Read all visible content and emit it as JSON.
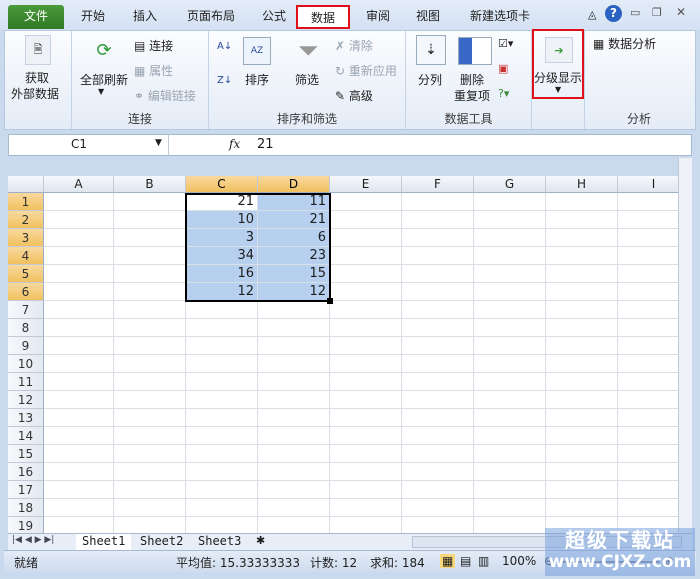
{
  "tabs": [
    "文件",
    "开始",
    "插入",
    "页面布局",
    "公式",
    "数据",
    "审阅",
    "视图",
    "新建选项卡"
  ],
  "ribbon": {
    "get_external": [
      "获取",
      "外部数据"
    ],
    "refresh_all": "全部刷新",
    "connections": "连接",
    "properties": "属性",
    "edit_links": "编辑链接",
    "group_connections": "连接",
    "sort": "排序",
    "filter": "筛选",
    "clear": "清除",
    "reapply": "重新应用",
    "advanced": "高级",
    "group_sort_filter": "排序和筛选",
    "text_to_columns": "分列",
    "remove_dup": [
      "删除",
      "重复项"
    ],
    "group_data_tools": "数据工具",
    "outline": "分级显示",
    "data_analysis": "数据分析",
    "group_analysis": "分析"
  },
  "formula_bar": {
    "name_box": "C1",
    "fx": "fx",
    "value": "21"
  },
  "columns": [
    "A",
    "B",
    "C",
    "D",
    "E",
    "F",
    "G",
    "H",
    "I"
  ],
  "rows": [
    "1",
    "2",
    "3",
    "4",
    "5",
    "6",
    "7",
    "8",
    "9",
    "10",
    "11",
    "12",
    "13",
    "14",
    "15",
    "16",
    "17",
    "18",
    "19"
  ],
  "data": {
    "C": [
      "21",
      "10",
      "3",
      "34",
      "16",
      "12"
    ],
    "D": [
      "11",
      "21",
      "6",
      "23",
      "15",
      "12"
    ]
  },
  "sheets": [
    "Sheet1",
    "Sheet2",
    "Sheet3"
  ],
  "status": {
    "ready": "就绪",
    "average": "平均值: 15.33333333",
    "count": "计数: 12",
    "sum": "求和: 184",
    "zoom": "100%"
  },
  "watermark": [
    "超级下载站",
    "www.CJXZ.com"
  ],
  "colors": {
    "accent": "#e0101a",
    "selection": "#b8d0f0",
    "header_sel": "#f1c15f"
  }
}
